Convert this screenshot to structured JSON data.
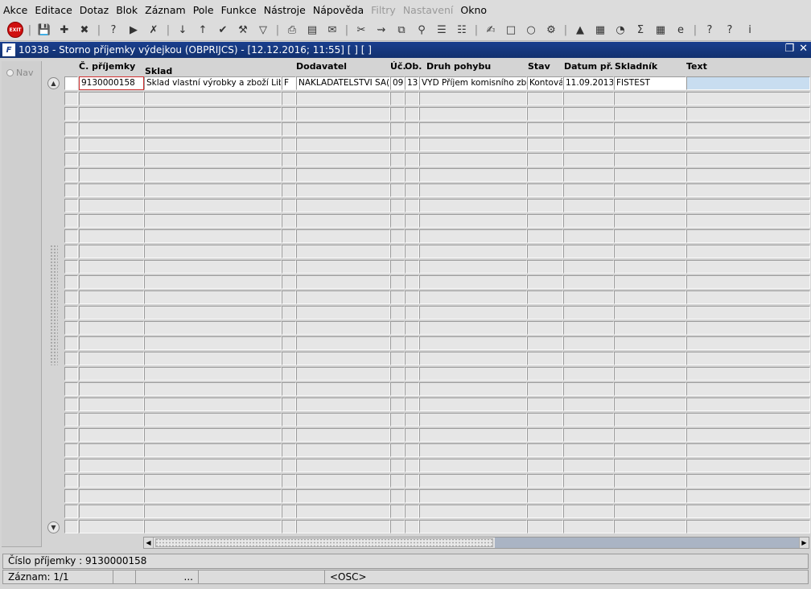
{
  "menu": [
    "Akce",
    "Editace",
    "Dotaz",
    "Blok",
    "Záznam",
    "Pole",
    "Funkce",
    "Nástroje",
    "Nápověda",
    "Filtry",
    "Nastavení",
    "Okno"
  ],
  "menu_disabled": [
    "Filtry",
    "Nastavení"
  ],
  "toolbar": {
    "exit_label": "EXIT",
    "icons": [
      "exit-icon",
      "save-icon",
      "new-record-icon",
      "delete-record-icon",
      "enter-query-icon",
      "execute-query-icon",
      "cancel-query-icon",
      "sort-asc-icon",
      "sort-desc-icon",
      "commit-icon",
      "tools-icon",
      "filter-icon",
      "print-icon",
      "preview-icon",
      "mail-icon",
      "cut-icon",
      "insert-icon",
      "copy-icon",
      "search-icon",
      "list-icon",
      "tree-icon",
      "clipboard-icon",
      "doc-icon",
      "globe-icon",
      "gear-icon",
      "chart-icon",
      "graph-icon",
      "clock-icon",
      "sum-icon",
      "excel-icon",
      "ie-icon",
      "help-context-icon",
      "help-icon",
      "info-icon"
    ]
  },
  "window": {
    "title": "10338 - Storno příjemky výdejkou (OBPRIJCS) - [12.12.2016; 11:55]  [ ] [ ]",
    "logo": "F"
  },
  "nav": {
    "label": "Nav"
  },
  "columns": {
    "cislo": "Č. příjemky",
    "sklad": "Sklad",
    "dodavatel": "Dodavatel",
    "uc": "Úč.",
    "ob": "Ob.",
    "druh": "Druh pohybu",
    "stav": "Stav",
    "datum": "Datum př.",
    "skladnik": "Skladník",
    "text": "Text"
  },
  "record": {
    "cislo": "9130000158",
    "sklad": "Sklad vlastní výrobky a zboží Liber",
    "flag": "F",
    "dodavatel": "NAKLADATELSTVI SA(",
    "uc": "09",
    "ob": "13",
    "druh": "VYD Příjem komisního zbož",
    "stav": "Kontová",
    "datum": "11.09.2013",
    "skladnik": "FISTEST",
    "text": ""
  },
  "status": {
    "field_info": "Číslo příjemky : 9130000158",
    "record": "Záznam: 1/1",
    "dots": "...",
    "mode": "<OSC>"
  }
}
